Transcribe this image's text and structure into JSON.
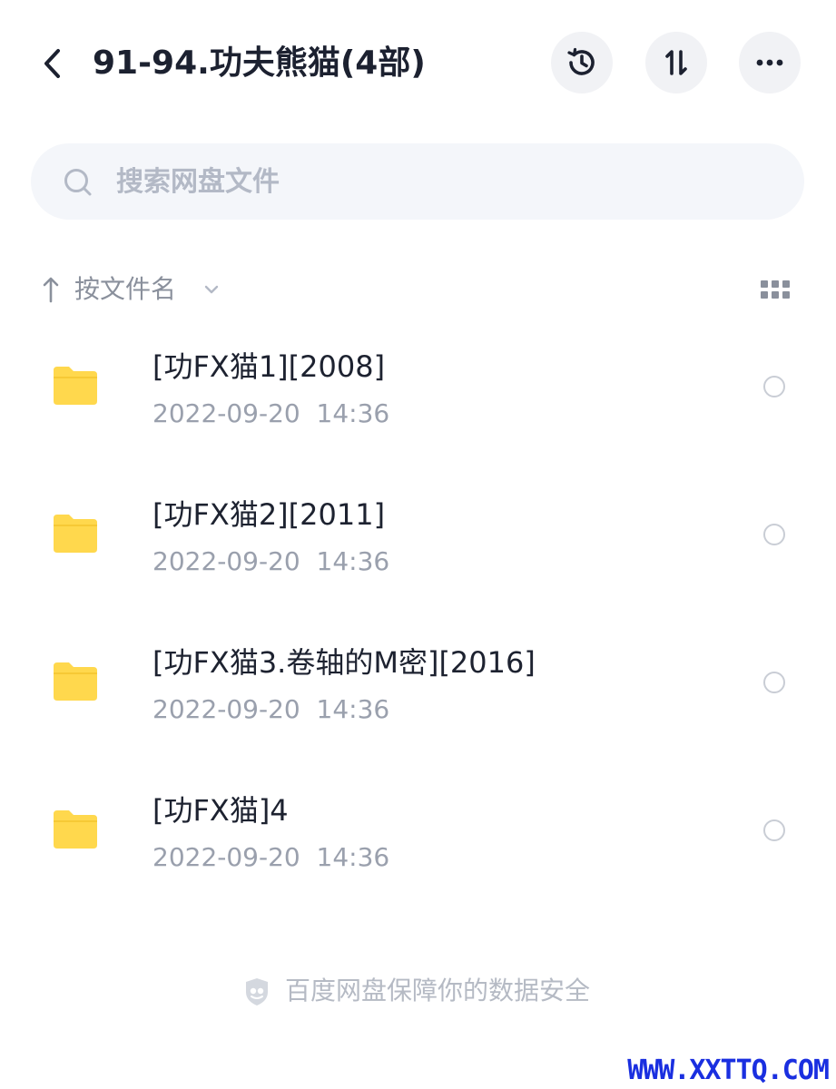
{
  "header": {
    "title": "91-94.功夫熊猫(4部)"
  },
  "icons": {
    "back": "chevron-left-icon",
    "history": "history-icon",
    "sort": "sort-arrows-icon",
    "more": "more-horizontal-icon",
    "search": "search-icon",
    "sort_direction": "arrow-up-icon",
    "sort_dropdown": "chevron-down-icon",
    "view_mode": "grid-icon",
    "folder": "folder-icon",
    "shield": "shield-icon"
  },
  "search": {
    "placeholder": "搜索网盘文件"
  },
  "sort_bar": {
    "label": "按文件名"
  },
  "files": [
    {
      "name": "[功FX猫1][2008]",
      "date": "2022-09-20  14:36"
    },
    {
      "name": "[功FX猫2][2011]",
      "date": "2022-09-20  14:36"
    },
    {
      "name": "[功FX猫3.卷轴的M密][2016]",
      "date": "2022-09-20  14:36"
    },
    {
      "name": "[功FX猫]4",
      "date": "2022-09-20  14:36"
    }
  ],
  "footer": {
    "text": "百度网盘保障你的数据安全"
  },
  "watermark": {
    "text": "WWW.XXTTQ.COM"
  },
  "colors": {
    "folder": "#ffd84d",
    "accent_watermark": "#1a2fe0",
    "button_bg": "#f1f2f5",
    "search_bg": "#f4f6fa"
  }
}
